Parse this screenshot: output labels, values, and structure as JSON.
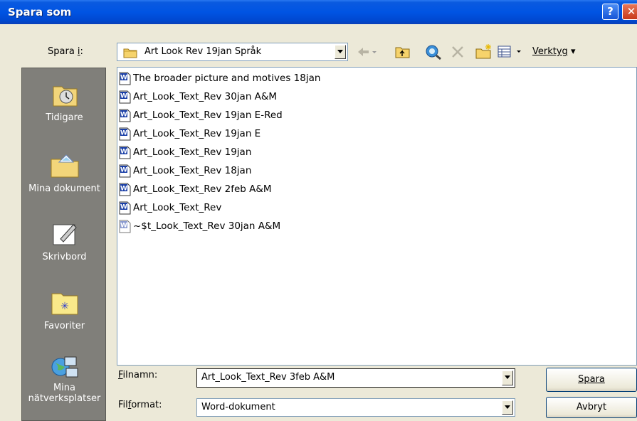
{
  "window": {
    "title": "Spara som"
  },
  "save_in": {
    "label": "Spara i:",
    "folder": "Art Look Rev 19jan Språk"
  },
  "toolbar": {
    "tools_label": "Verktyg"
  },
  "places": [
    {
      "label": "Tidigare",
      "icon": "history-icon"
    },
    {
      "label": "Mina dokument",
      "icon": "my-documents-icon"
    },
    {
      "label": "Skrivbord",
      "icon": "desktop-icon"
    },
    {
      "label": "Favoriter",
      "icon": "favorites-icon"
    },
    {
      "label": "Mina nätverksplatser",
      "label_line1": "Mina",
      "label_line2": "nätverksplatser",
      "icon": "network-places-icon"
    }
  ],
  "files": [
    {
      "name": "The broader picture and motives 18jan",
      "icon": "word-document-icon"
    },
    {
      "name": "Art_Look_Text_Rev 30jan A&M",
      "icon": "word-document-icon"
    },
    {
      "name": "Art_Look_Text_Rev 19jan E-Red",
      "icon": "word-document-icon"
    },
    {
      "name": "Art_Look_Text_Rev 19jan E",
      "icon": "word-document-icon"
    },
    {
      "name": "Art_Look_Text_Rev 19jan",
      "icon": "word-document-icon"
    },
    {
      "name": "Art_Look_Text_Rev 18jan",
      "icon": "word-document-icon"
    },
    {
      "name": "Art_Look_Text_Rev 2feb A&M",
      "icon": "word-document-icon"
    },
    {
      "name": "Art_Look_Text_Rev",
      "icon": "word-document-icon"
    },
    {
      "name": "~$t_Look_Text_Rev 30jan A&M",
      "icon": "word-temp-document-icon"
    }
  ],
  "filename": {
    "label": "Filnamn:",
    "value": "Art_Look_Text_Rev 3feb A&M"
  },
  "filetype": {
    "label": "Filformat:",
    "value": "Word-dokument"
  },
  "buttons": {
    "save": "Spara",
    "cancel": "Avbryt"
  },
  "colors": {
    "titlebar": "#0054e3",
    "places_bg": "#807f7a",
    "dialog_bg": "#ece9d8"
  }
}
